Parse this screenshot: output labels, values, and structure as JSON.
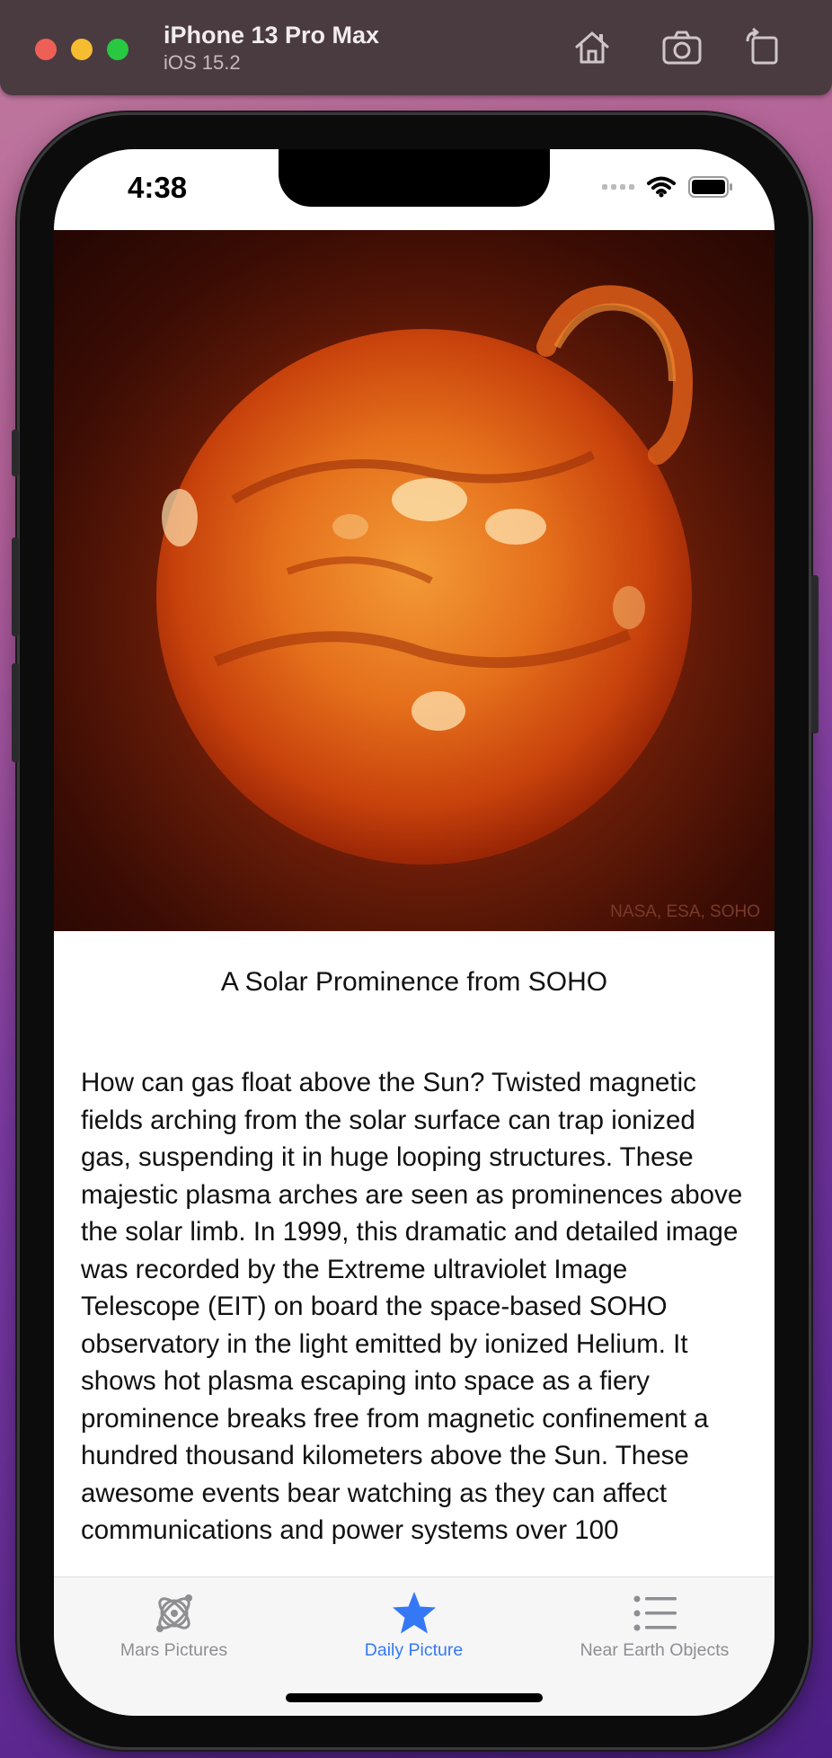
{
  "simulator": {
    "device_name": "iPhone 13 Pro Max",
    "os_version": "iOS 15.2",
    "toolbar": [
      "home-icon",
      "screenshot-icon",
      "rotate-icon"
    ]
  },
  "status_bar": {
    "time": "4:38"
  },
  "apod": {
    "image_credit": "NASA, ESA, SOHO",
    "title": "A Solar Prominence from SOHO",
    "explanation": "How can gas float above the Sun?   Twisted magnetic fields arching from the solar surface can trap ionized gas, suspending it in huge looping structures.  These majestic plasma arches are seen as prominences above the solar limb.  In 1999, this dramatic and detailed image was recorded by the Extreme ultraviolet Image Telescope (EIT) on board the space-based SOHO observatory in the light emitted by ionized Helium.  It shows hot plasma escaping into space as a fiery prominence breaks free from magnetic confinement a hundred thousand kilometers above the Sun.  These awesome events bear watching as they can affect communications and power systems over 100"
  },
  "tabs": [
    {
      "label": "Mars Pictures",
      "icon": "atom-icon",
      "selected": false
    },
    {
      "label": "Daily Picture",
      "icon": "star-icon",
      "selected": true
    },
    {
      "label": "Near Earth Objects",
      "icon": "list-icon",
      "selected": false
    }
  ],
  "colors": {
    "accent": "#3478f6",
    "inactive_tab": "#8e8e93",
    "titlebar": "#4a3b40"
  }
}
